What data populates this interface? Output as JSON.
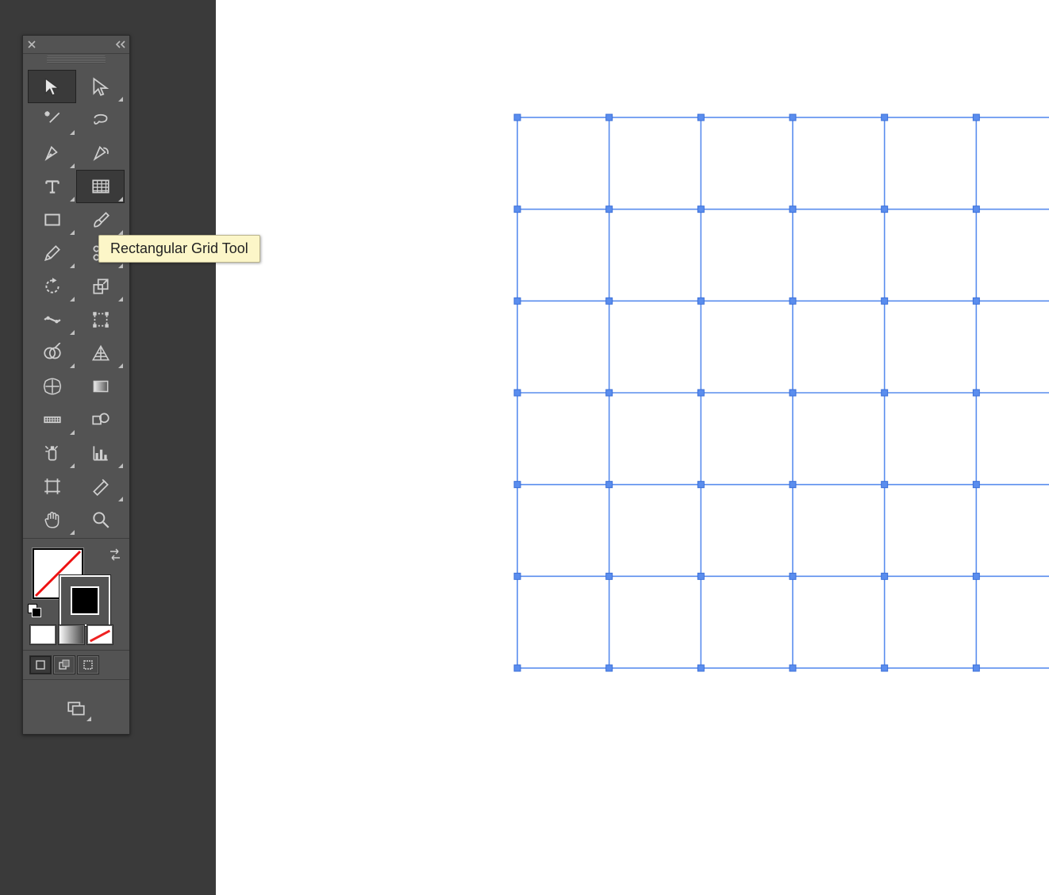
{
  "tooltip": {
    "text": "Rectangular Grid Tool"
  },
  "tools": {
    "row1": [
      "selection-tool",
      "direct-selection-tool"
    ],
    "row2": [
      "magic-wand-tool",
      "lasso-tool"
    ],
    "row3": [
      "pen-tool",
      "curvature-tool"
    ],
    "row4": [
      "type-tool",
      "rectangular-grid-tool"
    ],
    "row5": [
      "rectangle-tool",
      "paintbrush-tool"
    ],
    "row6": [
      "pencil-tool",
      "scissors-tool"
    ],
    "row7": [
      "rotate-tool",
      "scale-tool"
    ],
    "row8": [
      "width-tool",
      "free-transform-tool"
    ],
    "row9": [
      "shape-builder-tool",
      "perspective-grid-tool"
    ],
    "row10": [
      "mesh-tool",
      "gradient-tool"
    ],
    "row11": [
      "eyedropper-tool",
      "blend-tool"
    ],
    "row12": [
      "symbol-sprayer-tool",
      "column-graph-tool"
    ],
    "row13": [
      "artboard-tool",
      "slice-tool"
    ],
    "row14": [
      "hand-tool",
      "zoom-tool"
    ]
  },
  "selected_tool": "rectangular-grid-tool",
  "grid": {
    "cols": 6,
    "rows": 6,
    "stroke": "#5a8dee",
    "handles": "7x7"
  },
  "color_modes": [
    "solid",
    "gradient",
    "none"
  ],
  "fill": "none",
  "stroke": "black"
}
